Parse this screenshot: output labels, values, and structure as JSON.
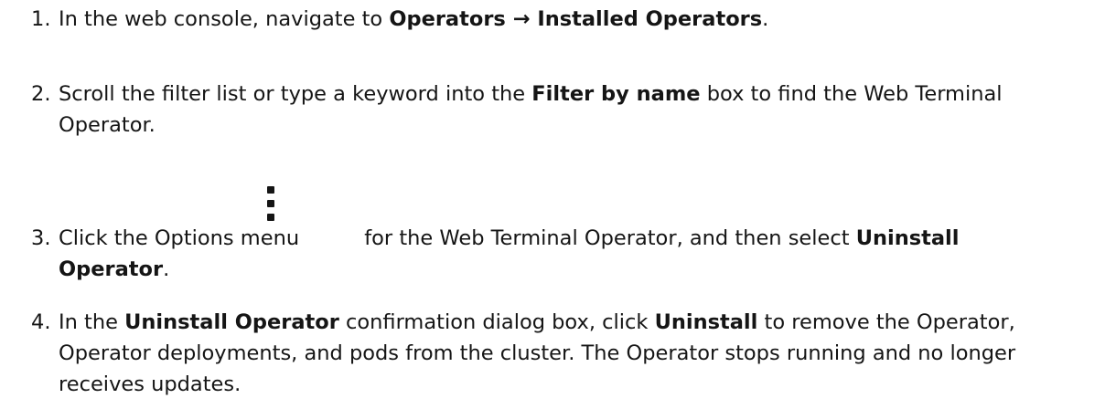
{
  "steps": [
    {
      "number": "1.",
      "text_a": "In the web console, navigate to ",
      "bold_a": "Operators → Installed Operators",
      "text_b": "."
    },
    {
      "number": "2.",
      "text_a": "Scroll the filter list or type a keyword into the ",
      "bold_a": "Filter by name",
      "text_b": " box to find the Web Terminal",
      "text_c": "Operator."
    },
    {
      "number": "3.",
      "text_a": "Click the Options menu",
      "icon": "kebab-options-icon",
      "text_b": "for the Web Terminal Operator, and then select ",
      "bold_a": "Uninstall",
      "bold_b": "Operator",
      "text_c": "."
    },
    {
      "number": "4.",
      "text_a": "In the ",
      "bold_a": "Uninstall Operator",
      "text_b": " confirmation dialog box, click  ",
      "bold_b": "Uninstall",
      "text_c": " to remove the Operator,",
      "text_d": "Operator deployments, and pods from the cluster. The Operator stops running and no longer",
      "text_e": "receives updates."
    }
  ]
}
